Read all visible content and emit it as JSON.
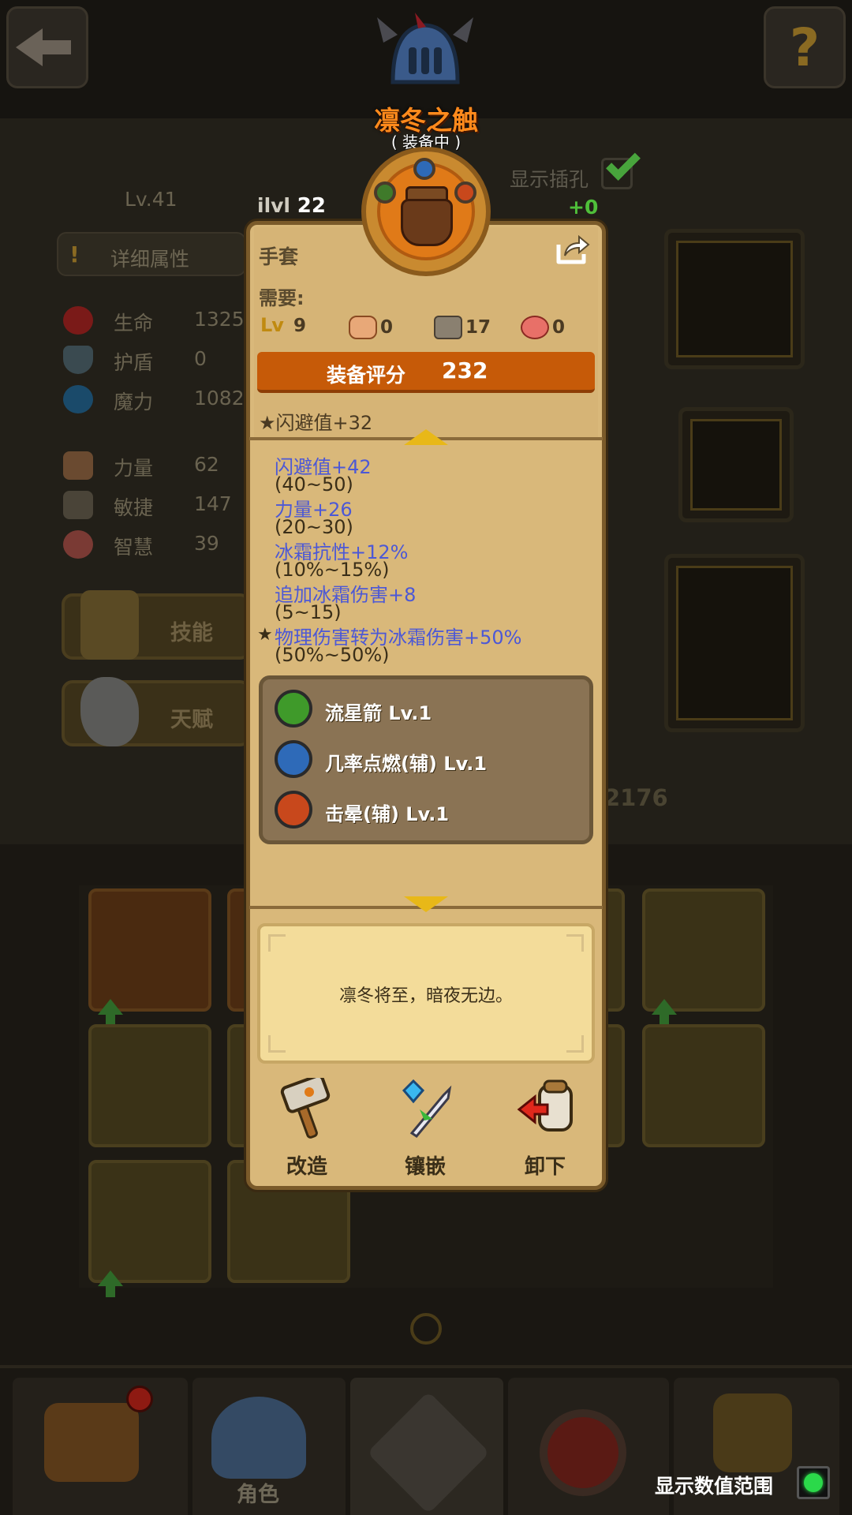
{
  "header": {
    "item_name": "凛冬之触",
    "item_status": "( 装备中 )"
  },
  "character": {
    "level": "Lv.41",
    "detail_button": "详细属性",
    "show_socket_label": "显示插孔",
    "socket_bonus": "+0",
    "stats": [
      {
        "icon": "heart-icon",
        "label": "生命",
        "value": "1325"
      },
      {
        "icon": "shield-icon",
        "label": "护盾",
        "value": "0"
      },
      {
        "icon": "mana-drop-icon",
        "label": "魔力",
        "value": "1082"
      },
      {
        "icon": "fist-icon",
        "label": "力量",
        "value": "62"
      },
      {
        "icon": "boot-icon",
        "label": "敏捷",
        "value": "147"
      },
      {
        "icon": "brain-icon",
        "label": "智慧",
        "value": "39"
      }
    ],
    "skill_button": "技能",
    "talent_button": "天赋",
    "right_number": "2176"
  },
  "tooltip": {
    "ilvl_label": "ilvl",
    "ilvl_value": "22",
    "type": "手套",
    "need_label": "需要:",
    "requirements": {
      "level_icon_text": "Lv",
      "level": "9",
      "strength": "0",
      "dexterity": "17",
      "wisdom": "0"
    },
    "score_label": "装备评分",
    "score_value": "232",
    "implicit": "闪避值+32",
    "affixes": [
      {
        "text": "闪避值+42",
        "range": "(40~50)",
        "starred": false
      },
      {
        "text": "力量+26",
        "range": "(20~30)",
        "starred": false
      },
      {
        "text": "冰霜抗性+12%",
        "range": "(10%~15%)",
        "starred": false
      },
      {
        "text": "追加冰霜伤害+8",
        "range": "(5~15)",
        "starred": false
      },
      {
        "text": "物理伤害转为冰霜伤害+50%",
        "range": "(50%~50%)",
        "starred": true
      }
    ],
    "star_glyph": "★",
    "gems": [
      {
        "icon": "arrow-gem-icon",
        "color": "#3f9a2a",
        "label": "流星箭  Lv.1"
      },
      {
        "icon": "ignite-gem-icon",
        "color": "#2e6ab8",
        "label": "几率点燃(辅) Lv.1"
      },
      {
        "icon": "stun-gem-icon",
        "color": "#c8481c",
        "label": "击晕(辅) Lv.1"
      }
    ],
    "description": "凛冬将至，暗夜无边。",
    "actions": [
      {
        "label": "改造"
      },
      {
        "label": "镶嵌"
      },
      {
        "label": "卸下"
      }
    ]
  },
  "bottom_nav": {
    "character_label": "角色",
    "range_label": "显示数值范围"
  },
  "colors": {
    "accent_orange": "#c65a08",
    "item_name": "#ff8a1c",
    "affix_blue": "#4c58d6",
    "toggle_on": "#2bd94a"
  }
}
